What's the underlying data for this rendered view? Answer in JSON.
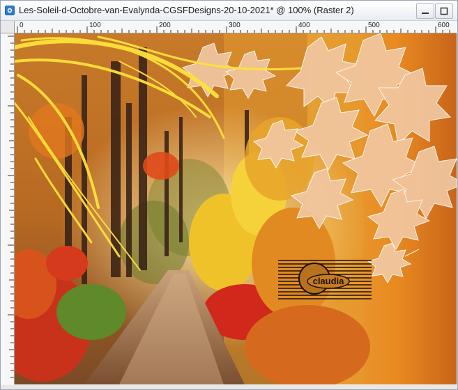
{
  "window": {
    "title": "Les-Soleil-d-Octobre-van-Evalynda-CGSFDesigns-20-10-2021* @ 100% (Raster 2)"
  },
  "icons": {
    "app": "psp-document-icon",
    "minimize": "minimize-icon",
    "maximize": "maximize-icon"
  },
  "ruler": {
    "h_labels": [
      "0",
      "100",
      "200",
      "300",
      "400",
      "500",
      "600"
    ]
  },
  "watermark": {
    "text": "claudia"
  },
  "colors": {
    "sky_orange": "#e88a20",
    "deep_orange": "#c8641a",
    "leaf_peach": "#f1c7a0",
    "path_brown": "#8a5a3a",
    "streak_yellow": "#ffe23a"
  }
}
